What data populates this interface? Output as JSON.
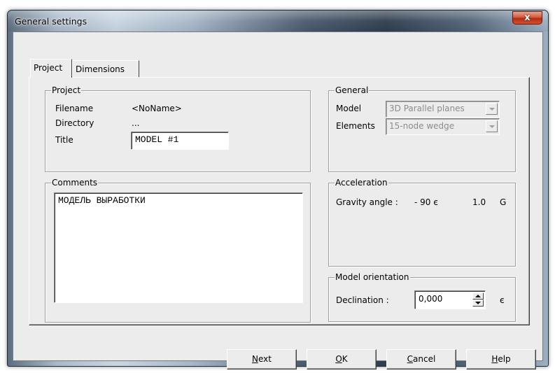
{
  "window": {
    "title": "General settings",
    "close_label": "x"
  },
  "tabs": [
    {
      "label": "Project",
      "active": true
    },
    {
      "label": "Dimensions",
      "active": false
    }
  ],
  "project_group": {
    "legend": "Project",
    "filename_label": "Filename",
    "filename_value": "<NoName>",
    "directory_label": "Directory",
    "directory_value": "...",
    "title_label": "Title",
    "title_value": "MODEL #1"
  },
  "comments_group": {
    "legend": "Comments",
    "text": "МОДЕЛЬ ВЫРАБОТКИ"
  },
  "general_group": {
    "legend": "General",
    "model_label": "Model",
    "model_value": "3D Parallel planes",
    "elements_label": "Elements",
    "elements_value": "15-node wedge"
  },
  "acceleration_group": {
    "legend": "Acceleration",
    "gravity_label": "Gravity angle :",
    "gravity_angle": "- 90 є",
    "gravity_value": "1.0",
    "gravity_unit": "G"
  },
  "orientation_group": {
    "legend": "Model orientation",
    "declination_label": "Declination :",
    "declination_value": "0,000",
    "declination_unit": "є"
  },
  "buttons": {
    "next": {
      "mnemonic": "N",
      "rest": "ext"
    },
    "ok": {
      "mnemonic": "O",
      "rest": "K"
    },
    "cancel": {
      "mnemonic": "C",
      "rest": "ancel"
    },
    "help": {
      "mnemonic": "H",
      "rest": "elp"
    }
  },
  "colors": {
    "dialog_face": "#ececec",
    "close_button": "#c9462a",
    "disabled_text": "#8c8c8c"
  }
}
